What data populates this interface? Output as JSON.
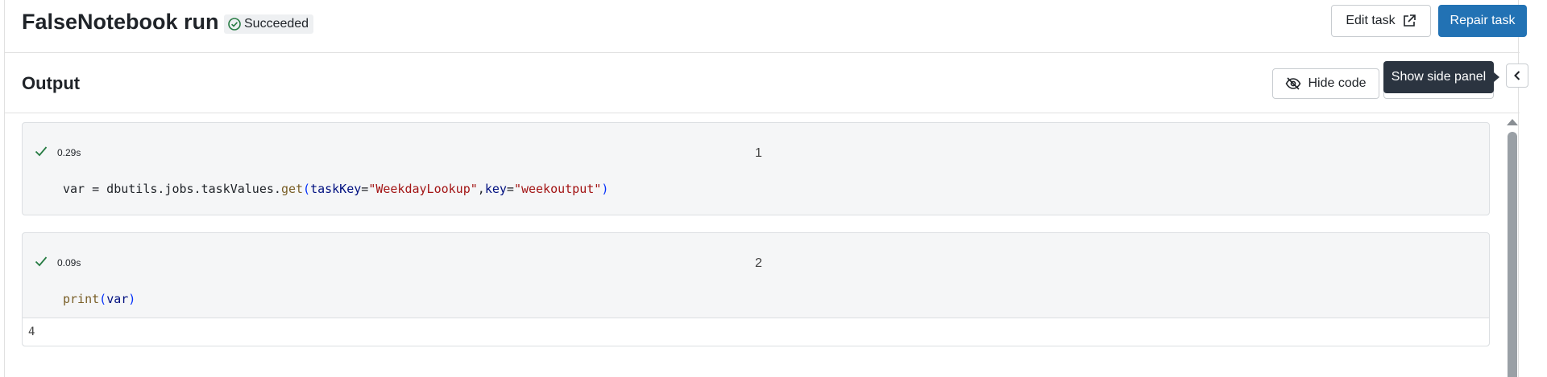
{
  "header": {
    "title": "FalseNotebook run",
    "status": "Succeeded",
    "edit_task_label": "Edit task",
    "repair_task_label": "Repair task"
  },
  "output": {
    "title": "Output",
    "hide_code_label": "Hide code",
    "tooltip": "Show side panel"
  },
  "cells": [
    {
      "duration": "0.29s",
      "number": "1",
      "code_tokens": {
        "t1": "var = dbutils.jobs.taskValues.",
        "t2": "get",
        "t3": "(",
        "t4": "taskKey",
        "t5": "=",
        "t6": "\"WeekdayLookup\"",
        "t7": ",",
        "t8": "key",
        "t9": "=",
        "t10": "\"weekoutput\"",
        "t11": ")"
      }
    },
    {
      "duration": "0.09s",
      "number": "2",
      "code_tokens": {
        "t1": "print",
        "t2": "(",
        "t3": "var",
        "t4": ")"
      },
      "output": "4"
    }
  ],
  "colors": {
    "primary": "#2272b4",
    "success": "#277c43",
    "tooltip_bg": "#2b3440"
  },
  "icons": {
    "status": "check-circle-icon",
    "edit_task": "external-link-icon",
    "hide_code": "eye-off-icon",
    "side_toggle": "chevron-left-icon",
    "cell_status": "check-icon"
  }
}
